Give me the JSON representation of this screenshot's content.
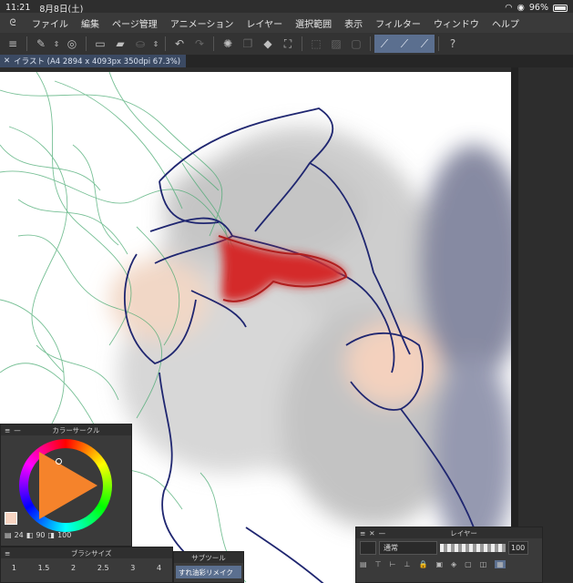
{
  "status": {
    "time": "11:21",
    "date": "8月8日(土)",
    "battery": "96%"
  },
  "menu": [
    "ファイル",
    "編集",
    "ページ管理",
    "アニメーション",
    "レイヤー",
    "選択範囲",
    "表示",
    "フィルター",
    "ウィンドウ",
    "ヘルプ"
  ],
  "document_tab": "イラスト (A4 2894 x 4093px 350dpi 67.3%)",
  "color_panel": {
    "title": "カラーサークル",
    "h": "24",
    "s": "90",
    "v": "100"
  },
  "brush_panel": {
    "title": "ブラシサイズ",
    "sizes": [
      "1",
      "1.5",
      "2",
      "2.5",
      "3",
      "4"
    ]
  },
  "subtool_panel": {
    "title": "サブツール",
    "item": "すれ油彩リメイク"
  },
  "layer_panel": {
    "title": "レイヤー",
    "blend_mode": "通常",
    "opacity": "100"
  },
  "colors": {
    "accent": "#5b6f8f",
    "main_color": "#f7d4c2"
  }
}
